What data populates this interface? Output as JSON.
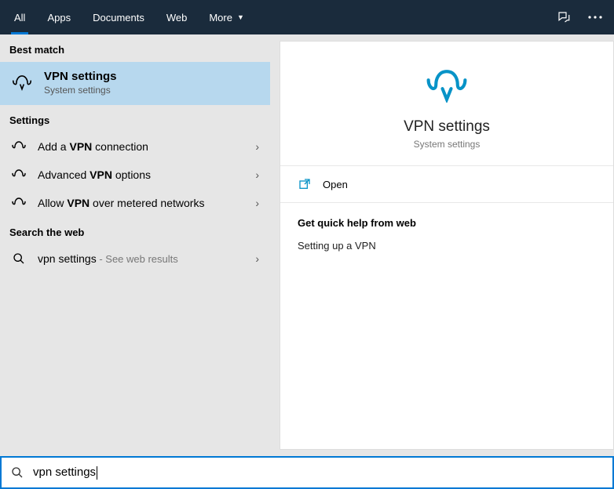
{
  "tabs": {
    "all": "All",
    "apps": "Apps",
    "documents": "Documents",
    "web": "Web",
    "more": "More"
  },
  "left": {
    "best_match_header": "Best match",
    "best_match": {
      "title": "VPN settings",
      "sub": "System settings"
    },
    "settings_header": "Settings",
    "settings": [
      {
        "pre": "Add a ",
        "bold": "VPN",
        "post": " connection"
      },
      {
        "pre": "Advanced ",
        "bold": "VPN",
        "post": " options"
      },
      {
        "pre": "Allow ",
        "bold": "VPN",
        "post": " over metered networks"
      }
    ],
    "web_header": "Search the web",
    "web_item": {
      "query": "vpn settings",
      "suffix": " - See web results"
    }
  },
  "right": {
    "hero_title": "VPN settings",
    "hero_sub": "System settings",
    "open": "Open",
    "help_title": "Get quick help from web",
    "help_link": "Setting up a VPN"
  },
  "search": {
    "value": "vpn settings"
  }
}
